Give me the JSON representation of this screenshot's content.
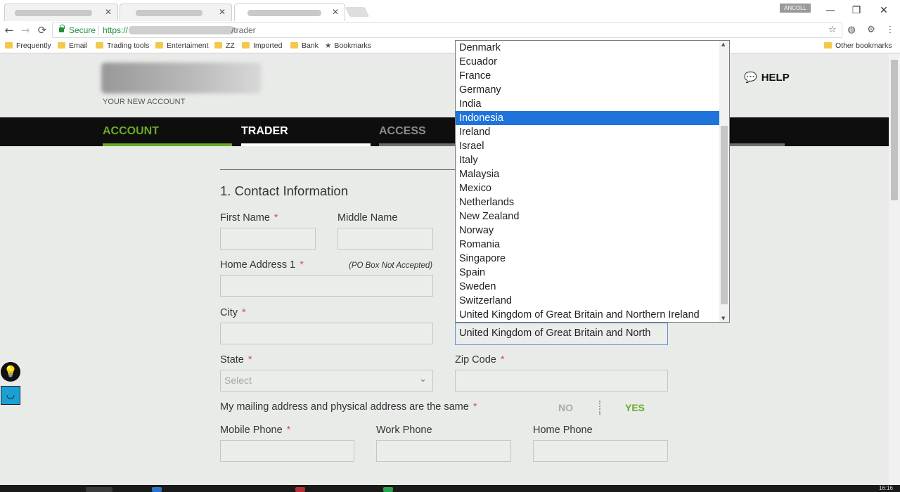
{
  "browser": {
    "user_badge": "ANCOLL",
    "window_controls": {
      "minimize": "—",
      "maximize": "❐",
      "close": "✕"
    },
    "nav": {
      "back": "←",
      "forward": "→",
      "reload": "⟳"
    },
    "address": {
      "secure_label": "Secure",
      "scheme": "https://",
      "path": "/trader"
    },
    "bookmarks": [
      {
        "label": "Frequently",
        "icon": "folder-icon"
      },
      {
        "label": "Email",
        "icon": "folder-icon"
      },
      {
        "label": "Trading tools",
        "icon": "folder-icon"
      },
      {
        "label": "Entertaiment",
        "icon": "folder-icon"
      },
      {
        "label": "ZZ",
        "icon": "folder-icon"
      },
      {
        "label": "Imported",
        "icon": "folder-icon"
      },
      {
        "label": "Bank",
        "icon": "folder-icon"
      },
      {
        "label": "Bookmarks",
        "icon": "star-icon"
      },
      {
        "label": "Other bookmarks",
        "icon": "folder-icon"
      }
    ]
  },
  "header": {
    "tagline": "YOUR NEW ACCOUNT",
    "help_label": "HELP"
  },
  "steps": [
    {
      "label": "ACCOUNT",
      "state": "complete",
      "color": "#6aaa24"
    },
    {
      "label": "TRADER",
      "state": "current",
      "color": "#ffffff"
    },
    {
      "label": "ACCESS",
      "state": "pending",
      "color": "#8a8a8a"
    }
  ],
  "form": {
    "section_title": "1. Contact Information",
    "first_name": {
      "label": "First Name",
      "required": "*",
      "value": ""
    },
    "middle_name": {
      "label": "Middle Name",
      "value": ""
    },
    "home_address_1": {
      "label": "Home Address 1",
      "required": "*",
      "hint": "(PO Box Not Accepted)",
      "value": ""
    },
    "city": {
      "label": "City",
      "required": "*",
      "value": ""
    },
    "country": {
      "value": "United Kingdom of Great Britain and North"
    },
    "state": {
      "label": "State",
      "required": "*",
      "placeholder": "Select"
    },
    "zip": {
      "label": "Zip Code",
      "required": "*",
      "value": ""
    },
    "same_address": {
      "label": "My mailing address and physical address are the same",
      "required": "*",
      "no": "NO",
      "yes": "YES",
      "selected": "YES"
    },
    "mobile_phone": {
      "label": "Mobile Phone",
      "required": "*",
      "value": ""
    },
    "work_phone": {
      "label": "Work Phone",
      "value": ""
    },
    "home_phone": {
      "label": "Home Phone",
      "value": ""
    }
  },
  "country_dropdown": {
    "selected": "Indonesia",
    "options": [
      "Denmark",
      "Ecuador",
      "France",
      "Germany",
      "India",
      "Indonesia",
      "Ireland",
      "Israel",
      "Italy",
      "Malaysia",
      "Mexico",
      "Netherlands",
      "New Zealand",
      "Norway",
      "Romania",
      "Singapore",
      "Spain",
      "Sweden",
      "Switzerland",
      "United Kingdom of Great Britain and Northern Ireland"
    ]
  },
  "taskbar": {
    "clock": "16:16"
  },
  "colors": {
    "accent_green": "#6aaa24",
    "selection_blue": "#1e74d9",
    "required_red": "#d9534f"
  }
}
